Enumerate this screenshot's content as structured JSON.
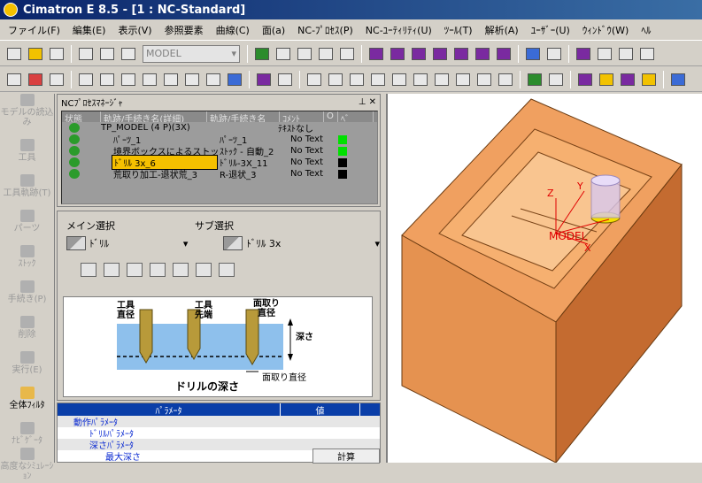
{
  "window": {
    "title": "Cimatron E 8.5 - [1 : NC-Standard]"
  },
  "menu": [
    "ファイル(F)",
    "編集(E)",
    "表示(V)",
    "参照要素",
    "曲線(C)",
    "面(a)",
    "NC-ﾌﾟﾛｾｽ(P)",
    "NC-ﾕｰﾃｨﾘﾃｨ(U)",
    "ﾂｰﾙ(T)",
    "解析(A)",
    "ﾕｰｻﾞｰ(U)",
    "ｳｨﾝﾄﾞｳ(W)",
    "ﾍﾙ"
  ],
  "toolbar": {
    "model_combo": "MODEL"
  },
  "sidebar": [
    {
      "label": "モデルの読込み",
      "active": false
    },
    {
      "label": "工具",
      "active": false
    },
    {
      "label": "工具軌跡(T)",
      "active": false
    },
    {
      "label": "パーツ",
      "active": false
    },
    {
      "label": "ｽﾄｯｸ",
      "active": false
    },
    {
      "label": "手続き(P)",
      "active": false
    },
    {
      "label": "削除",
      "active": false
    },
    {
      "label": "実行(E)",
      "active": false
    },
    {
      "label": "全体ﾌｨﾙﾀ",
      "active": true
    },
    {
      "label": "ﾅﾋﾞｹﾞｰﾀ",
      "active": false
    },
    {
      "label": "高度なｼﾐｭﾚｰｼｮﾝ",
      "active": false
    }
  ],
  "ncpm": {
    "title": "NCﾌﾟﾛｾｽﾏﾈｰｼﾞｬ",
    "columns": [
      "状態",
      "軌跡/手続き名(詳細)",
      "軌跡/手続き名",
      "ｺﾒﾝﾄ",
      "O",
      "ﾍﾞ"
    ],
    "rows": [
      {
        "name": "TP_MODEL (4 P)(3X)",
        "short": "",
        "comment": "ﾃｷｽﾄなし",
        "indicator": "none"
      },
      {
        "name": "ﾊﾟｰﾂ_1",
        "short": "ﾊﾟｰﾂ_1",
        "comment": "No Text",
        "indicator": "green"
      },
      {
        "name": "境界ボックスによるストック_2",
        "short": "ｽﾄｯｸ - 自動_2",
        "comment": "No Text",
        "indicator": "green"
      },
      {
        "name": "ﾄﾞﾘﾙ 3x_6",
        "short": "ﾄﾞﾘﾙ-3X_11",
        "comment": "No Text",
        "indicator": "black"
      },
      {
        "name": "荒取り加工-退状荒_3",
        "short": "R-退状_3",
        "comment": "No Text",
        "indicator": "black"
      }
    ]
  },
  "selection": {
    "main_label": "メイン選択",
    "sub_label": "サブ選択",
    "main_value": "ﾄﾞﾘﾙ",
    "sub_value": "ﾄﾞﾘﾙ 3x",
    "diagram": {
      "tool_dia": "工具\n直径",
      "tool_tip": "工具\n先端",
      "chamfer_dia": "面取り\n直径",
      "depth": "深さ",
      "chamfer_dia2": "面取り直径",
      "caption": "ドリルの深さ"
    }
  },
  "params": {
    "col_param": "ﾊﾟﾗﾒｰﾀ",
    "col_value": "値",
    "rows": [
      {
        "label": "動作ﾊﾟﾗﾒｰﾀ",
        "indent": 0,
        "value": ""
      },
      {
        "label": "ﾄﾞﾘﾙﾊﾟﾗﾒｰﾀ",
        "indent": 1,
        "value": ""
      },
      {
        "label": "深さﾊﾟﾗﾒｰﾀ",
        "indent": 1,
        "value": ""
      },
      {
        "label": "最大深さ",
        "indent": 2,
        "value": "計算"
      }
    ]
  },
  "viewport": {
    "labels": {
      "x": "X",
      "y": "Y",
      "z": "Z",
      "model": "MODEL"
    }
  },
  "colors": {
    "block": "#f0a060",
    "block_dark": "#c46b30",
    "axis": "#e00000",
    "tool": "#f5e000"
  }
}
